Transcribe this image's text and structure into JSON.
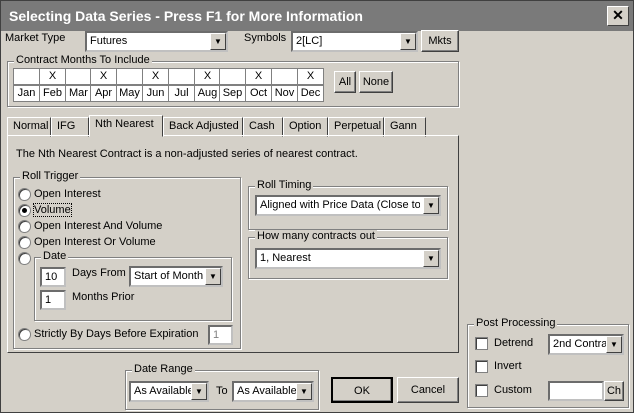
{
  "window": {
    "title": "Selecting Data Series - Press F1 for More Information",
    "close_label": "✕"
  },
  "market_type": {
    "label": "Market Type",
    "value": "Futures"
  },
  "symbols": {
    "label": "Symbols",
    "value": "2[LC]",
    "mkts_label": "Mkts"
  },
  "contract_months": {
    "title": "Contract Months To Include",
    "months": [
      {
        "label": "Jan",
        "mark": ""
      },
      {
        "label": "Feb",
        "mark": "X"
      },
      {
        "label": "Mar",
        "mark": ""
      },
      {
        "label": "Apr",
        "mark": "X"
      },
      {
        "label": "May",
        "mark": ""
      },
      {
        "label": "Jun",
        "mark": "X"
      },
      {
        "label": "Jul",
        "mark": ""
      },
      {
        "label": "Aug",
        "mark": "X"
      },
      {
        "label": "Sep",
        "mark": ""
      },
      {
        "label": "Oct",
        "mark": "X"
      },
      {
        "label": "Nov",
        "mark": ""
      },
      {
        "label": "Dec",
        "mark": "X"
      }
    ],
    "all_label": "All",
    "none_label": "None"
  },
  "tabs": [
    {
      "label": "Normal"
    },
    {
      "label": "IFG"
    },
    {
      "label": "Nth Nearest"
    },
    {
      "label": "Back Adjusted"
    },
    {
      "label": "Cash"
    },
    {
      "label": "Option"
    },
    {
      "label": "Perpetual"
    },
    {
      "label": "Gann"
    }
  ],
  "active_tab": "Nth Nearest",
  "panel": {
    "description": "The Nth Nearest Contract is a non-adjusted series of nearest contract.",
    "roll_trigger": {
      "title": "Roll Trigger",
      "options": [
        "Open Interest",
        "Volume",
        "Open Interest And Volume",
        "Open Interest Or Volume"
      ],
      "selected": "Volume",
      "date_option": "Date",
      "days_value": "10",
      "days_from_label": "Days From",
      "days_from_value": "Start of Month",
      "months_value": "1",
      "months_prior_label": "Months Prior",
      "expiration_option": "Strictly By Days Before Expiration",
      "expiration_value": "1"
    },
    "roll_timing": {
      "title": "Roll Timing",
      "value": "Aligned with Price Data (Close to C"
    },
    "contracts_out": {
      "title": "How many contracts out",
      "value": "1, Nearest"
    }
  },
  "post_processing": {
    "title": "Post Processing",
    "detrend_label": "Detrend",
    "detrend_value": "2nd Contra",
    "invert_label": "Invert",
    "custom_label": "Custom",
    "custom_value": "",
    "ch_label": "Ch"
  },
  "date_range": {
    "title": "Date Range",
    "from_value": "As Available",
    "to_label": "To",
    "to_value": "As Available"
  },
  "ok_label": "OK",
  "cancel_label": "Cancel"
}
